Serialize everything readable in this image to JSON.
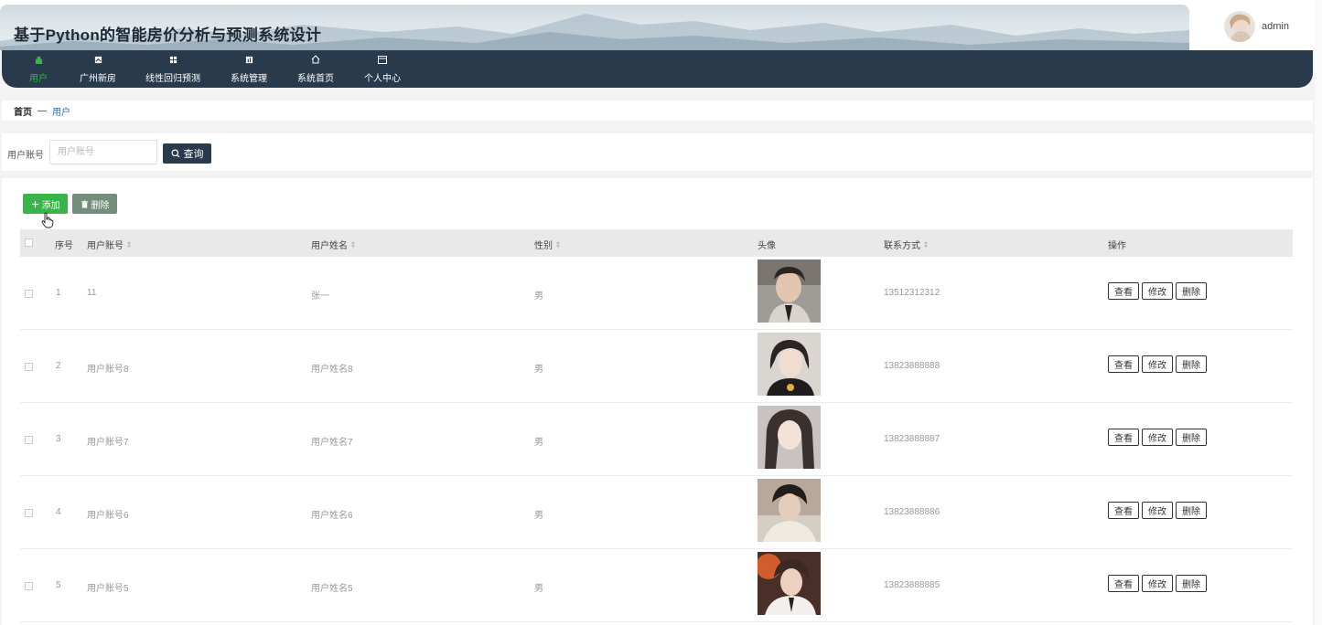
{
  "header": {
    "app_title": "基于Python的智能房价分析与预测系统设计",
    "username": "admin"
  },
  "nav": {
    "items": [
      {
        "label": "用户",
        "icon": "user-icon"
      },
      {
        "label": "广州新房",
        "icon": "building-icon"
      },
      {
        "label": "线性回归预测",
        "icon": "grid-icon"
      },
      {
        "label": "系统管理",
        "icon": "chart-icon"
      },
      {
        "label": "系统首页",
        "icon": "home-icon"
      },
      {
        "label": "个人中心",
        "icon": "profile-icon"
      }
    ],
    "active_index": 0
  },
  "breadcrumb": {
    "home": "首页",
    "separator": "—",
    "current": "用户"
  },
  "search": {
    "label": "用户账号",
    "placeholder": "用户账号",
    "value": "",
    "button_label": "查询"
  },
  "toolbar": {
    "add_label": "添加",
    "delete_label": "删除"
  },
  "table": {
    "columns": [
      "序号",
      "用户账号",
      "用户姓名",
      "性别",
      "头像",
      "联系方式",
      "操作"
    ],
    "rows": [
      {
        "index": "1",
        "account": "11",
        "name": "张一",
        "gender": "男",
        "phone": "13512312312",
        "avatar": "male-photo-1"
      },
      {
        "index": "2",
        "account": "用户账号8",
        "name": "用户姓名8",
        "gender": "男",
        "phone": "13823888888",
        "avatar": "female-photo-1"
      },
      {
        "index": "3",
        "account": "用户账号7",
        "name": "用户姓名7",
        "gender": "男",
        "phone": "13823888887",
        "avatar": "female-photo-2"
      },
      {
        "index": "4",
        "account": "用户账号6",
        "name": "用户姓名6",
        "gender": "男",
        "phone": "13823888886",
        "avatar": "male-photo-2"
      },
      {
        "index": "5",
        "account": "用户账号5",
        "name": "用户姓名5",
        "gender": "男",
        "phone": "13823888885",
        "avatar": "male-photo-3"
      }
    ],
    "actions": {
      "view": "查看",
      "edit": "修改",
      "delete": "删除"
    }
  },
  "colors": {
    "nav_bg": "#283a4b",
    "accent_green": "#39b449",
    "delete_gray_green": "#748e7c",
    "link_blue": "#2c6fb0"
  }
}
